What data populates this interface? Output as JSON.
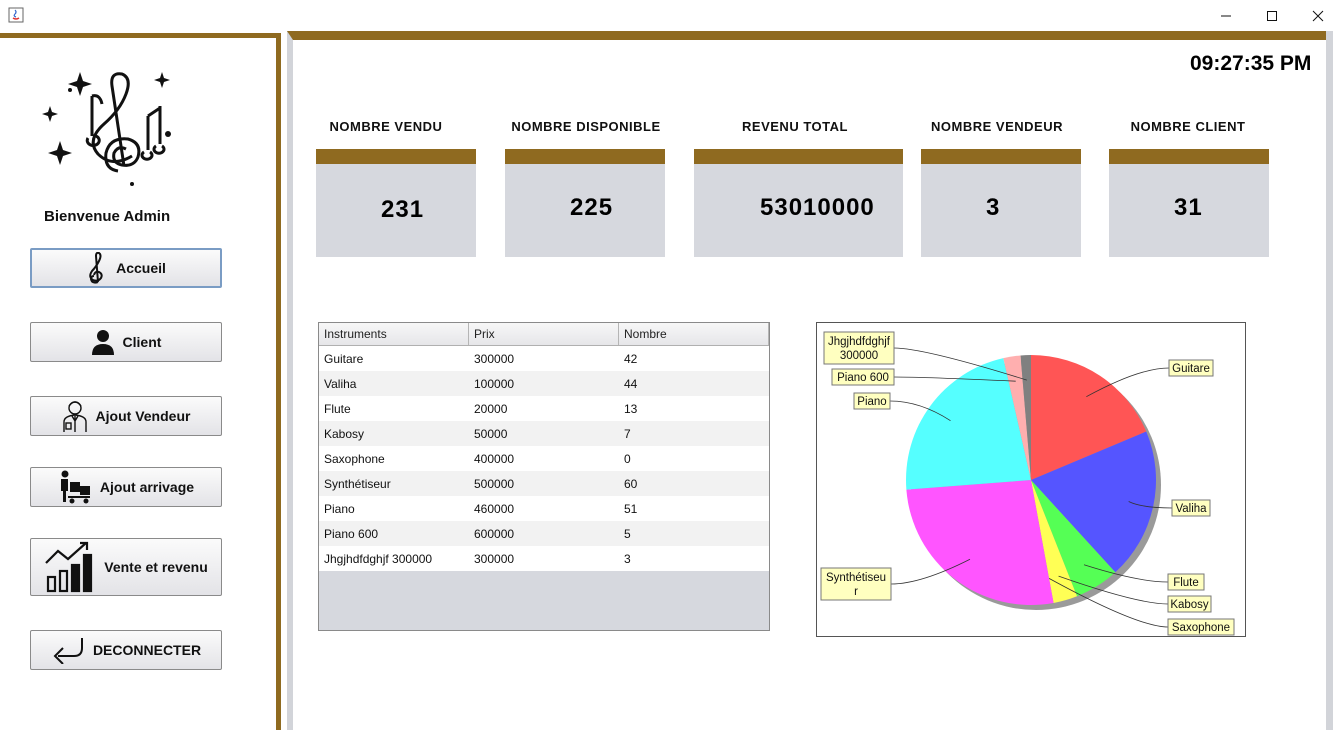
{
  "window": {
    "minimize_icon": "minimize-icon",
    "maximize_icon": "maximize-icon",
    "close_icon": "close-icon"
  },
  "sidebar": {
    "welcome": "Bienvenue Admin",
    "items": [
      {
        "label": "Accueil",
        "icon": "treble-clef-icon"
      },
      {
        "label": "Client",
        "icon": "user-icon"
      },
      {
        "label": "Ajout Vendeur",
        "icon": "seller-icon"
      },
      {
        "label": "Ajout arrivage",
        "icon": "delivery-icon"
      },
      {
        "label": "Vente et revenu",
        "icon": "growth-chart-icon"
      },
      {
        "label": "DECONNECTER",
        "icon": "back-arrow-icon"
      }
    ]
  },
  "header": {
    "clock": "09:27:35 PM"
  },
  "stats": [
    {
      "label": "NOMBRE VENDU",
      "value": "231"
    },
    {
      "label": "NOMBRE DISPONIBLE",
      "value": "225"
    },
    {
      "label": "REVENU TOTAL",
      "value": "53010000"
    },
    {
      "label": "NOMBRE VENDEUR",
      "value": "3"
    },
    {
      "label": "NOMBRE CLIENT",
      "value": "31"
    }
  ],
  "table": {
    "headers": [
      "Instruments",
      "Prix",
      "Nombre"
    ],
    "rows": [
      [
        "Guitare",
        "300000",
        "42"
      ],
      [
        "Valiha",
        "100000",
        "44"
      ],
      [
        "Flute",
        "20000",
        "13"
      ],
      [
        "Kabosy",
        "50000",
        "7"
      ],
      [
        "Saxophone",
        "400000",
        "0"
      ],
      [
        "Synthétiseur",
        "500000",
        "60"
      ],
      [
        "Piano",
        "460000",
        "51"
      ],
      [
        "Piano 600",
        "600000",
        "5"
      ],
      [
        "Jhgjhdfdghjf 300000",
        "300000",
        "3"
      ]
    ]
  },
  "chart_data": {
    "type": "pie",
    "categories": [
      "Guitare",
      "Valiha",
      "Flute",
      "Kabosy",
      "Saxophone",
      "Synthétiseur",
      "Piano",
      "Piano 600",
      "Jhgjhdfdghjf 300000"
    ],
    "values": [
      42,
      44,
      13,
      7,
      0,
      60,
      51,
      5,
      3
    ],
    "colors": [
      "#ff5555",
      "#5555ff",
      "#55ff55",
      "#ffff55",
      "#ff55ff",
      "#ff55ff",
      "#55ffff",
      "#ffafaf",
      "#808080"
    ],
    "labels_display": [
      "Guitare",
      "Valiha",
      "Flute",
      "Kabosy",
      "Saxophone",
      "Synthétiseur",
      "Piano",
      "Piano 600",
      "Jhgjhdfdghjf 300000"
    ]
  }
}
